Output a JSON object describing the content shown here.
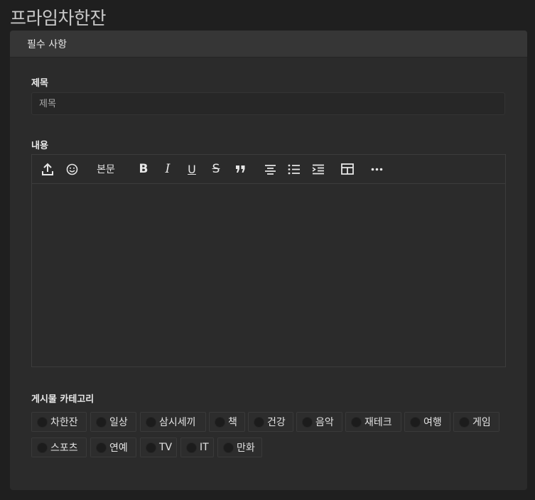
{
  "app": {
    "title": "프라임차한잔"
  },
  "section": {
    "header": "필수 사항"
  },
  "title_field": {
    "label": "제목",
    "placeholder": "제목",
    "value": ""
  },
  "content_field": {
    "label": "내용",
    "toolbar": {
      "upload_icon": "upload-icon",
      "emoji_icon": "emoji-icon",
      "style_label": "본문",
      "bold": "B",
      "italic": "I",
      "underline": "U",
      "strike": "S",
      "quote_icon": "quote-icon",
      "align_icon": "align-center-icon",
      "list_icon": "bullet-list-icon",
      "indent_icon": "indent-icon",
      "table_icon": "table-icon",
      "more_icon": "more-icon"
    }
  },
  "categories": {
    "label": "게시물 카테고리",
    "items": [
      "차한잔",
      "일상",
      "삼시세끼",
      "책",
      "건강",
      "음악",
      "재테크",
      "여행",
      "게임",
      "스포츠",
      "연예",
      "TV",
      "IT",
      "만화"
    ]
  }
}
